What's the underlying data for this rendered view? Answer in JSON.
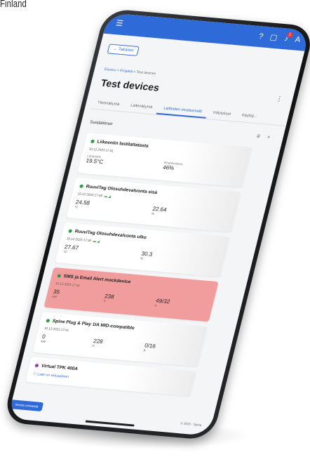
{
  "caption": "Finland",
  "topbar": {
    "help_icon": "?",
    "chat_icon": "▢",
    "notif_icon": "♪",
    "notif_count": "1",
    "user_initial": "A"
  },
  "back_label": "← Takaisin",
  "breadcrumb": {
    "a": "Etusivu",
    "sep1": ">",
    "b": "Projektit",
    "sep2": ">",
    "c": "Test devices"
  },
  "page_title": "Test devices",
  "tabs": [
    "Yleisnäkymä",
    "Laitenäkymä",
    "Laitteiden mveleemelit",
    "Hälytykset",
    "Käyttöj..."
  ],
  "filters_label": "Suodattimet",
  "cards": [
    {
      "title": "Liikeeniin lastilattatasta",
      "timestamp": "10.12.2023 17:41",
      "m1_label": "Lämpötila",
      "m1_val": "19.5°C",
      "m2_label": "Ilmankosteus",
      "m2_val": "46%"
    },
    {
      "title": "RuuviTag Olosuhdevalvonta sisä",
      "timestamp": "10.12.2023 17:39",
      "m1_val": "24.58",
      "m1_unit": "°C",
      "m2_val": "22.64",
      "m2_unit": "%"
    },
    {
      "title": "RuuviTag Olosuhdevalvonta ulko",
      "timestamp": "10.12.2023 17:39",
      "m1_val": "27.67",
      "m1_unit": "°C",
      "m2_val": "30.3",
      "m2_unit": "%"
    },
    {
      "title": "SMS ja Email Alert mockdevice",
      "timestamp": "10.12.2023 17:41",
      "m1_val": "35",
      "m1_unit": "kW",
      "m2_val": "238",
      "m2_unit": "V",
      "m3_val": "49/32",
      "m3_unit": "A"
    },
    {
      "title": "Spine Plug & Play 1IA MID-compatible",
      "timestamp": "10.12.2023 17:41",
      "m1_val": "0",
      "m1_unit": "kW",
      "m2_val": "228",
      "m2_unit": "V",
      "m3_val": "0/16",
      "m3_unit": "A"
    },
    {
      "title": "Virtual TPK 400A",
      "info": "Laite on virtuaalinen"
    }
  ],
  "bottom_left_label": "Ilmoita virheestä",
  "footer": "© 2023 · Spine",
  "colors": {
    "primary": "#2f6bd8",
    "alert": "#f29d9d",
    "status_ok": "#2e9b3f",
    "status_virtual": "#8e44ad"
  }
}
